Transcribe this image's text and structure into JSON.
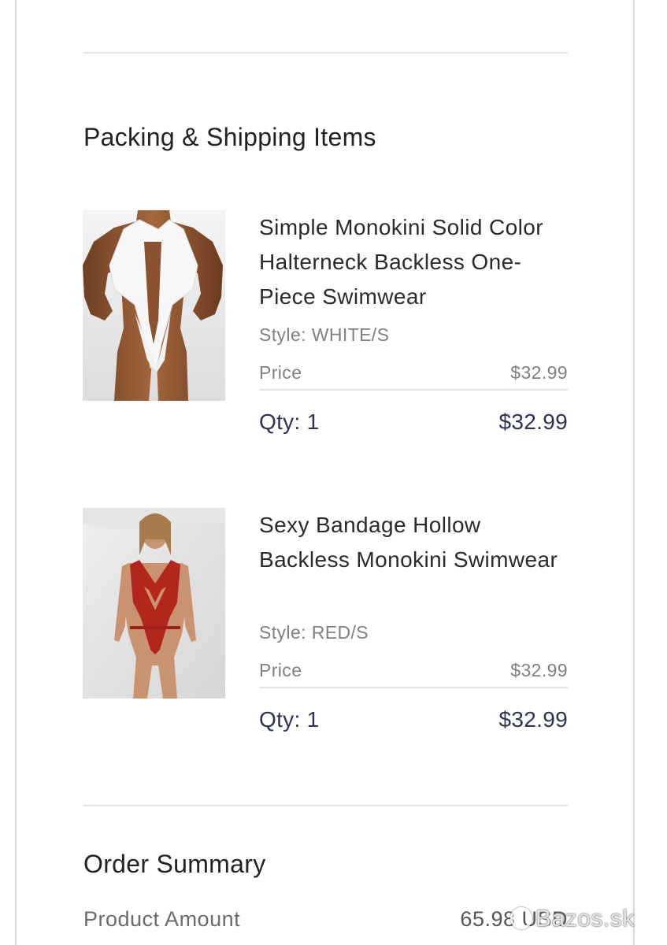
{
  "packing": {
    "title": "Packing & Shipping Items",
    "items": [
      {
        "name": "Simple Monokini Solid Color Halterneck Backless One-Piece Swimwear",
        "style": "Style: WHITE/S",
        "price_label": "Price",
        "price": "$32.99",
        "qty": "Qty: 1",
        "total": "$32.99",
        "image": "product-photo-white-monokini"
      },
      {
        "name": "Sexy Bandage Hollow Backless Monokini Swimwear",
        "style": "Style: RED/S",
        "price_label": "Price",
        "price": "$32.99",
        "qty": "Qty: 1",
        "total": "$32.99",
        "image": "product-photo-red-monokini"
      }
    ]
  },
  "summary": {
    "title": "Order Summary",
    "product_amount_label": "Product Amount",
    "product_amount_value": "65.98 USD"
  },
  "watermark": "Bazos.sk",
  "colors": {
    "text_dark": "#222222",
    "text_muted": "#808080",
    "qty_text": "#2e3350",
    "divider": "#e3e3e3"
  }
}
